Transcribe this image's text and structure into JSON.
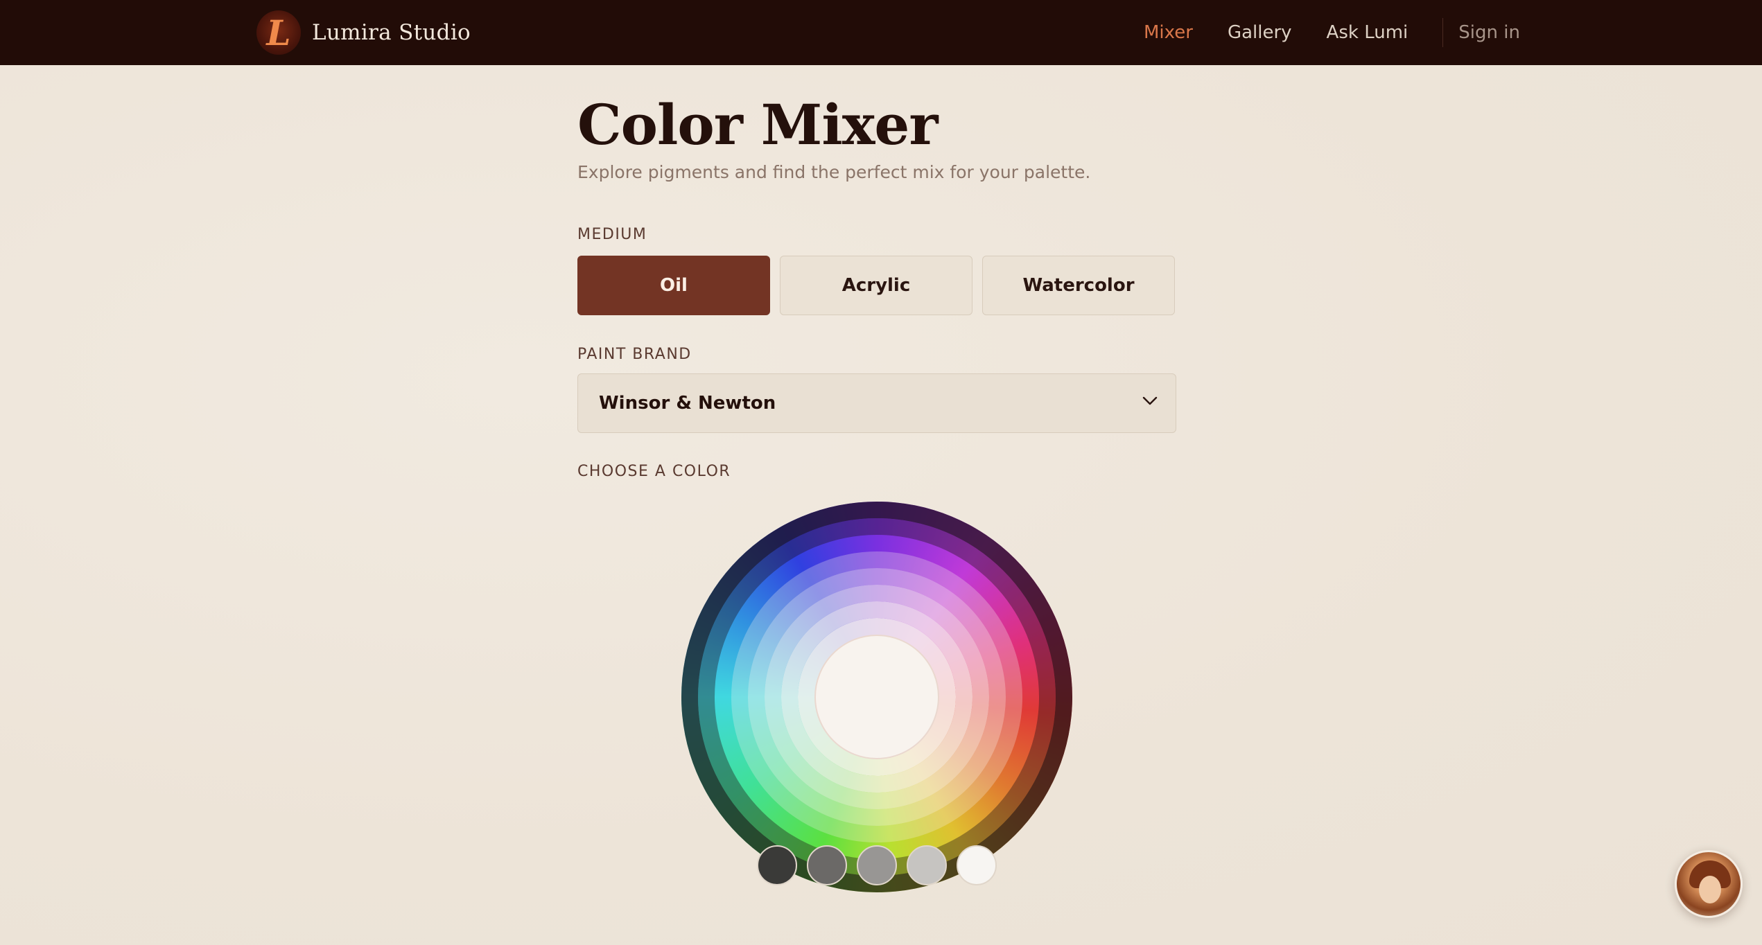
{
  "app": {
    "brand_initial": "L",
    "brand_name": "Lumira Studio"
  },
  "nav": {
    "links": [
      "Mixer",
      "Gallery",
      "Ask Lumi"
    ],
    "active": "Mixer",
    "signin": "Sign in"
  },
  "page": {
    "title": "Color Mixer",
    "subtitle": "Explore pigments and find the perfect mix for your palette."
  },
  "medium": {
    "label": "MEDIUM",
    "options": [
      "Oil",
      "Acrylic",
      "Watercolor"
    ],
    "selected": "Oil"
  },
  "paint_brand": {
    "label": "PAINT BRAND",
    "value": "Winsor & Newton"
  },
  "color": {
    "label": "CHOOSE A COLOR",
    "neutral_swatches": [
      "#3a3a38",
      "#6b6967",
      "#989694",
      "#c6c4c1",
      "#f7f5f2"
    ]
  },
  "colors": {
    "nav_bg": "#220c07",
    "accent": "#d9774a",
    "selected_button": "#733424"
  },
  "icons": {
    "select": "chevron-down-icon",
    "assistant": "assistant-avatar"
  }
}
